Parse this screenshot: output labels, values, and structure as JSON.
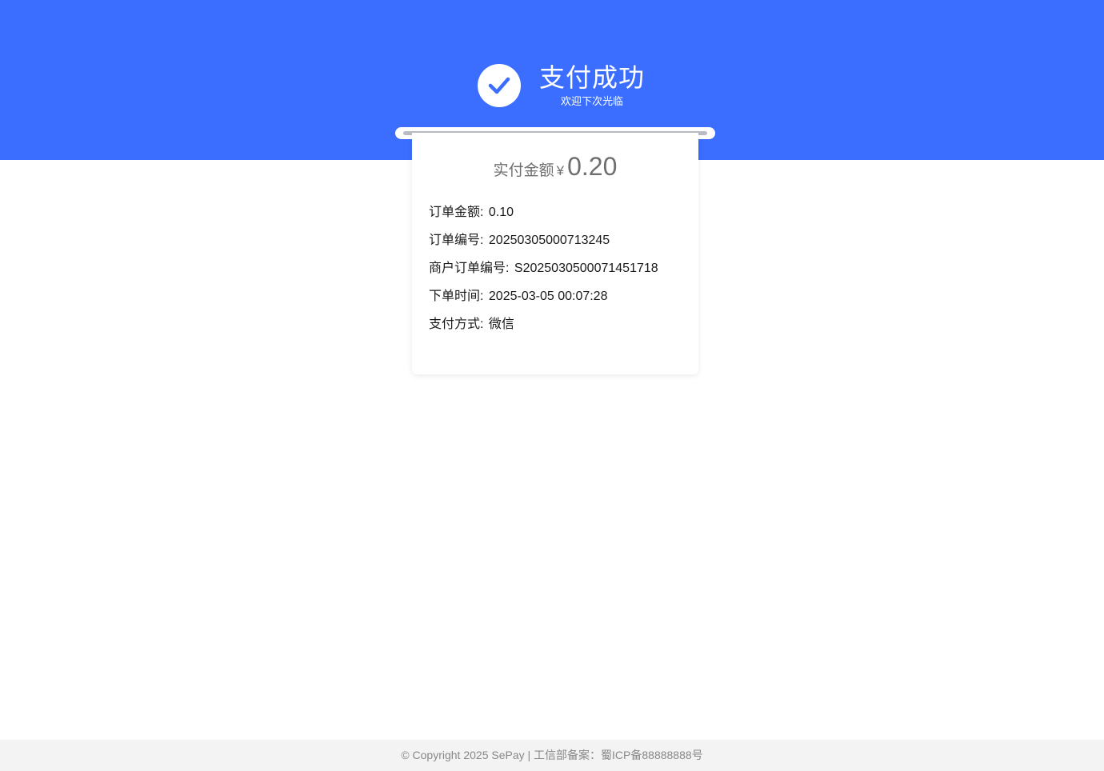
{
  "header": {
    "title": "支付成功",
    "subtitle": "欢迎下次光临",
    "icon": "check-icon",
    "background_color": "#3b6eff"
  },
  "receipt": {
    "paid_label": "实付金额",
    "currency": "¥",
    "paid_amount": "0.20",
    "details": [
      {
        "label": "订单金额:",
        "value": "0.10"
      },
      {
        "label": "订单编号:",
        "value": "20250305000713245"
      },
      {
        "label": "商户订单编号:",
        "value": "S2025030500071451718"
      },
      {
        "label": "下单时间:",
        "value": "2025-03-05 00:07:28"
      },
      {
        "label": "支付方式:",
        "value": "微信"
      }
    ]
  },
  "footer": {
    "text": "© Copyright 2025 SePay | 工信部备案：蜀ICP备88888888号"
  }
}
